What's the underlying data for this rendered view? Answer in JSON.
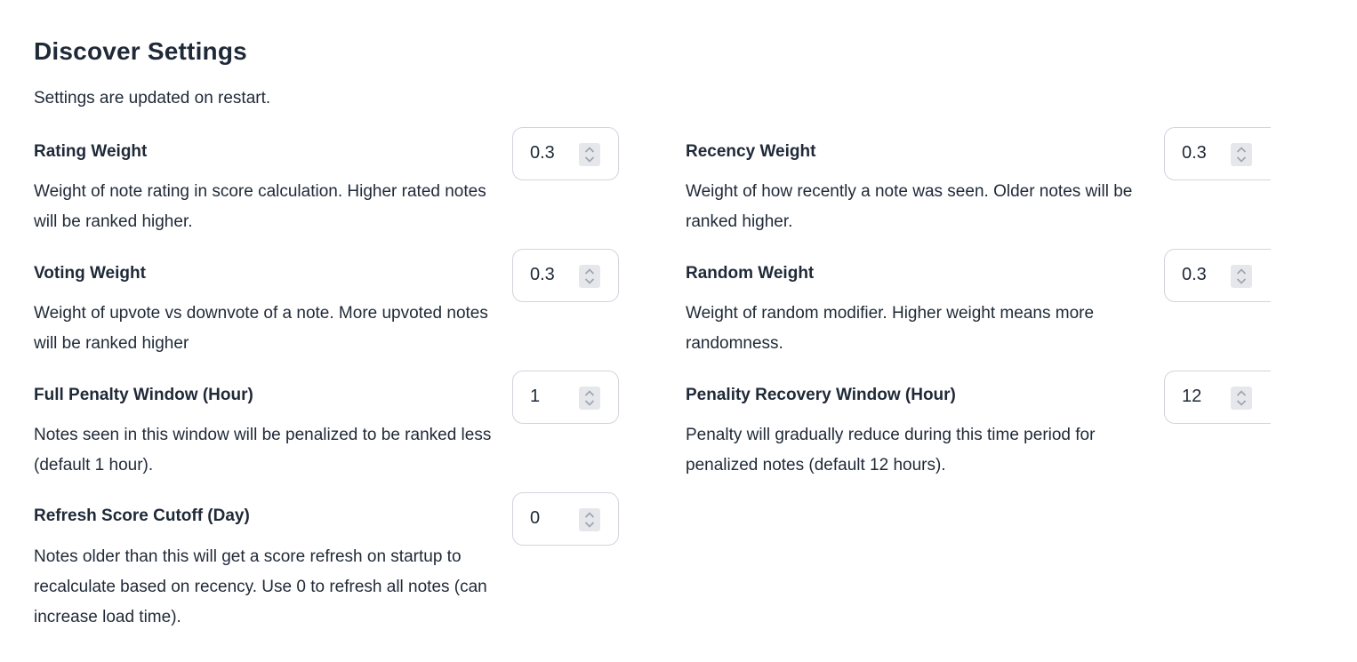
{
  "header": {
    "title": "Discover Settings",
    "subtitle": "Settings are updated on restart."
  },
  "settings": [
    {
      "name": "Rating Weight",
      "description": "Weight of note rating in score calculation. Higher rated notes will be ranked higher.",
      "value": "0.3"
    },
    {
      "name": "Recency Weight",
      "description": "Weight of how recently a note was seen. Older notes will be ranked higher.",
      "value": "0.3"
    },
    {
      "name": "Voting Weight",
      "description": "Weight of upvote vs downvote of a note. More upvoted notes will be ranked higher",
      "value": "0.3"
    },
    {
      "name": "Random Weight",
      "description": "Weight of random modifier. Higher weight means more randomness.",
      "value": "0.3"
    },
    {
      "name": "Full Penalty Window (Hour)",
      "description": "Notes seen in this window will be penalized to be ranked less (default 1 hour).",
      "value": "1"
    },
    {
      "name": "Penality Recovery Window (Hour)",
      "description": "Penalty will gradually reduce during this time period for penalized notes (default 12 hours).",
      "value": "12"
    },
    {
      "name": "Refresh Score Cutoff (Day)",
      "description": "Notes older than this will get a score refresh on startup to recalculate based on recency. Use 0 to refresh all notes (can increase load time).",
      "value": "0"
    }
  ],
  "icons": {
    "spinner": "spinner-updown-icon"
  },
  "colors": {
    "text": "#1f2937",
    "border": "#d1d5db",
    "spinner_bg": "#e5e7eb"
  }
}
